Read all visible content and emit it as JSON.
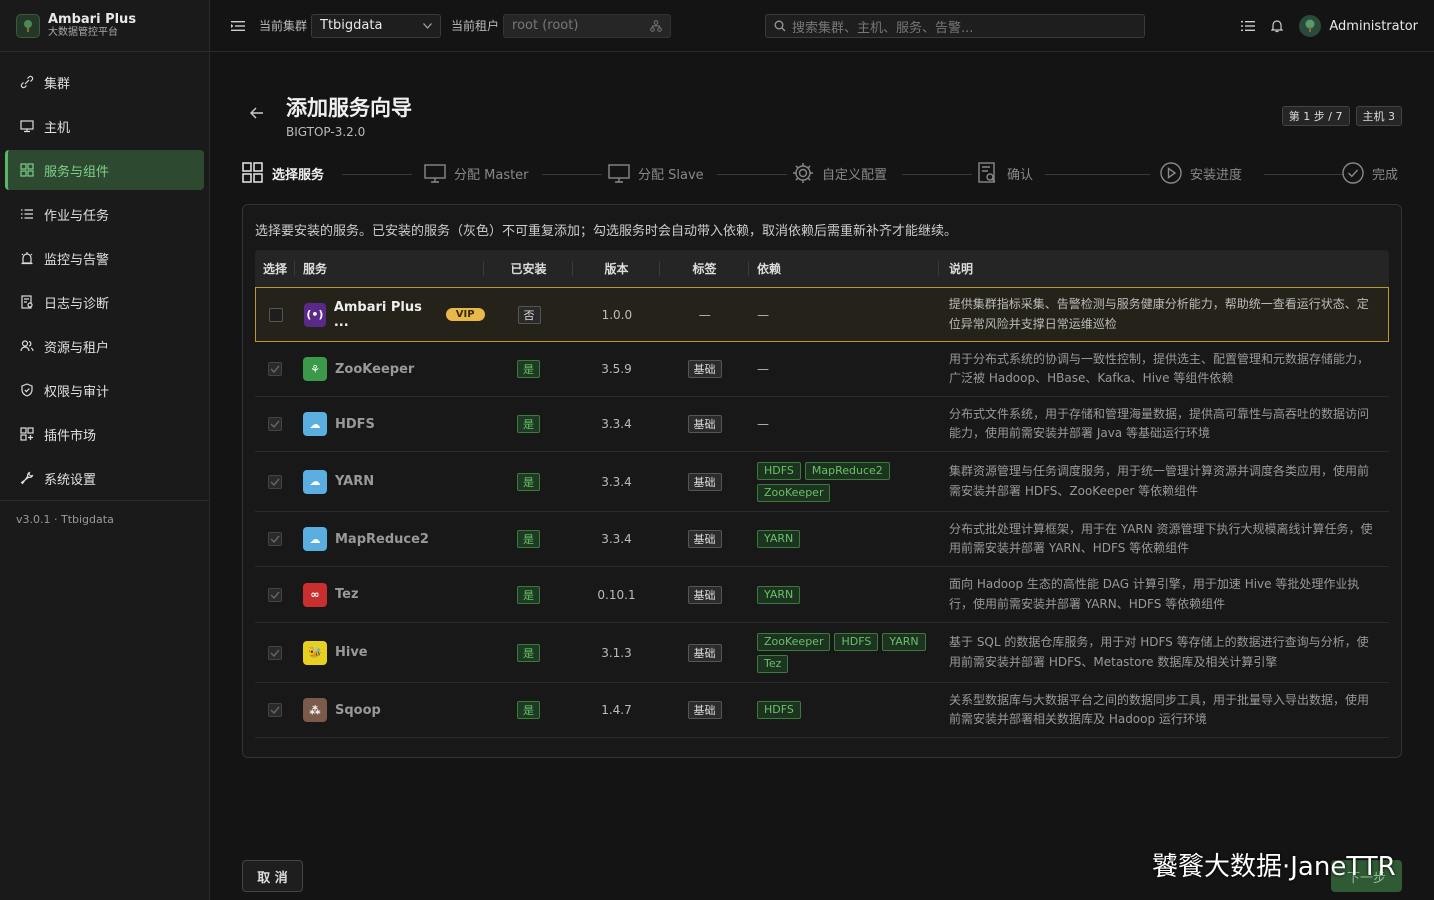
{
  "app": {
    "title": "Ambari Plus",
    "subtitle": "大数据管控平台",
    "version": "v3.0.1 · Ttbigdata"
  },
  "sidebar": {
    "items": [
      {
        "label": "集群",
        "icon": "link-icon"
      },
      {
        "label": "主机",
        "icon": "monitor-icon"
      },
      {
        "label": "服务与组件",
        "icon": "grid-icon",
        "active": true
      },
      {
        "label": "作业与任务",
        "icon": "list-icon"
      },
      {
        "label": "监控与告警",
        "icon": "alarm-icon"
      },
      {
        "label": "日志与诊断",
        "icon": "log-icon"
      },
      {
        "label": "资源与租户",
        "icon": "users-icon"
      },
      {
        "label": "权限与审计",
        "icon": "shield-icon"
      },
      {
        "label": "插件市场",
        "icon": "plugin-icon"
      },
      {
        "label": "系统设置",
        "icon": "wrench-icon"
      }
    ]
  },
  "topbar": {
    "cluster_label": "当前集群",
    "cluster_value": "Ttbigdata",
    "tenant_label": "当前租户",
    "tenant_value": "root (root)",
    "search_placeholder": "搜索集群、主机、服务、告警...",
    "user": "Administrator"
  },
  "page": {
    "title": "添加服务向导",
    "subtitle": "BIGTOP-3.2.0",
    "badge_step": "第 1 步 / 7",
    "badge_hosts": "主机 3",
    "description": "选择要安装的服务。已安装的服务（灰色）不可重复添加；勾选服务时会自动带入依赖，取消依赖后需重新补齐才能继续。"
  },
  "steps": [
    "选择服务",
    "分配 Master",
    "分配 Slave",
    "自定义配置",
    "确认",
    "安装进度",
    "完成"
  ],
  "table": {
    "headers": [
      "选择",
      "服务",
      "已安装",
      "版本",
      "标签",
      "依赖",
      "说明"
    ],
    "rows": [
      {
        "name": "Ambari Plus ...",
        "vip": "VIP",
        "installed": "否",
        "version": "1.0.0",
        "tag": "—",
        "deps": [],
        "deps_empty": "—",
        "desc": "提供集群指标采集、告警检测与服务健康分析能力，帮助统一查看运行状态、定位异常风险并支撑日常运维巡检",
        "color": "#5a2a8a",
        "glyph": "(•)"
      },
      {
        "name": "ZooKeeper",
        "installed": "是",
        "version": "3.5.9",
        "tag": "基础",
        "deps": [],
        "deps_empty": "—",
        "desc": "用于分布式系统的协调与一致性控制，提供选主、配置管理和元数据存储能力，广泛被 Hadoop、HBase、Kafka、Hive 等组件依赖",
        "color": "#3a9a4a",
        "glyph": "⚘"
      },
      {
        "name": "HDFS",
        "installed": "是",
        "version": "3.3.4",
        "tag": "基础",
        "deps": [],
        "deps_empty": "—",
        "desc": "分布式文件系统，用于存储和管理海量数据，提供高可靠性与高吞吐的数据访问能力，使用前需安装并部署 Java 等基础运行环境",
        "color": "#5aaee0",
        "glyph": "☁"
      },
      {
        "name": "YARN",
        "installed": "是",
        "version": "3.3.4",
        "tag": "基础",
        "deps": [
          "HDFS",
          "MapReduce2",
          "ZooKeeper"
        ],
        "deps_empty": "",
        "desc": "集群资源管理与任务调度服务，用于统一管理计算资源并调度各类应用，使用前需安装并部署 HDFS、ZooKeeper 等依赖组件",
        "color": "#5aaee0",
        "glyph": "☁"
      },
      {
        "name": "MapReduce2",
        "installed": "是",
        "version": "3.3.4",
        "tag": "基础",
        "deps": [
          "YARN"
        ],
        "deps_empty": "",
        "desc": "分布式批处理计算框架，用于在 YARN 资源管理下执行大规模离线计算任务，使用前需安装并部署 YARN、HDFS 等依赖组件",
        "color": "#5aaee0",
        "glyph": "☁"
      },
      {
        "name": "Tez",
        "installed": "是",
        "version": "0.10.1",
        "tag": "基础",
        "deps": [
          "YARN"
        ],
        "deps_empty": "",
        "desc": "面向 Hadoop 生态的高性能 DAG 计算引擎，用于加速 Hive 等批处理作业执行，使用前需安装并部署 YARN、HDFS 等依赖组件",
        "color": "#c83030",
        "glyph": "∞"
      },
      {
        "name": "Hive",
        "installed": "是",
        "version": "3.1.3",
        "tag": "基础",
        "deps": [
          "ZooKeeper",
          "HDFS",
          "YARN",
          "Tez"
        ],
        "deps_empty": "",
        "desc": "基于 SQL 的数据仓库服务，用于对 HDFS 等存储上的数据进行查询与分析，使用前需安装并部署 HDFS、Metastore 数据库及相关计算引擎",
        "color": "#e8d020",
        "glyph": "🐝"
      },
      {
        "name": "Sqoop",
        "installed": "是",
        "version": "1.4.7",
        "tag": "基础",
        "deps": [
          "HDFS"
        ],
        "deps_empty": "",
        "desc": "关系型数据库与大数据平台之间的数据同步工具，用于批量导入导出数据，使用前需安装并部署相关数据库及 Hadoop 运行环境",
        "color": "#7a5a4a",
        "glyph": "⁂"
      }
    ]
  },
  "footer": {
    "cancel": "取 消",
    "next": "下一步",
    "watermark": "饕餮大数据·JaneTTR"
  }
}
